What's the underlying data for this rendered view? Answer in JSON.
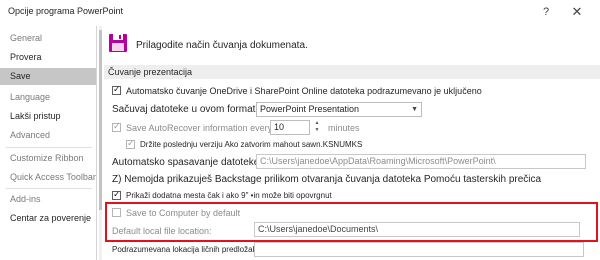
{
  "window": {
    "title": "Opcije programa PowerPoint",
    "help": "?",
    "close": "✕"
  },
  "sidebar": {
    "items": [
      {
        "label": "General",
        "muted": true
      },
      {
        "label": "Provera",
        "muted": false
      },
      {
        "label": "Save",
        "selected": true
      },
      {
        "label": "Language",
        "muted": true
      },
      {
        "label": "Lakši pristup",
        "muted": false
      },
      {
        "label": "Advanced",
        "muted": true
      },
      {
        "label": "Customize Ribbon",
        "muted": true
      },
      {
        "label": "Quick Access Toolbar",
        "muted": true
      },
      {
        "label": "Add-ins",
        "muted": true
      },
      {
        "label": "Centar za poverenje",
        "muted": false
      }
    ]
  },
  "main": {
    "header": "Prilagodite način čuvanja dokumenata.",
    "section_title": "Čuvanje prezentacija",
    "autosave_label": "Automatsko čuvanje OneDrive i SharePoint Online datoteka podrazumevano je uključeno",
    "format_label": "Sačuvaj datoteke u ovom formatu",
    "format_value": "PowerPoint Presentation",
    "autorecover_label": "Save AutoRecover information every",
    "autorecover_value": "10",
    "autorecover_unit": "minutes",
    "keep_last_label": "Držite poslednju verziju Ako zatvorim mahout sawn.KSNUMKS",
    "autorecover_location_label": "Automatsko spasavanje datoteke Lokacije:",
    "autorecover_location_value": "C:\\Users\\janedoe\\AppData\\Roaming\\Microsoft\\PowerPoint\\",
    "backstage_label": "Z) Nemojda prikazuješ Backstage prilikom otvaranja čuvanja datoteka Pomoću tasterskih prečica",
    "show_more_label": "Prikaži dodatna mesta čak i ako 9\" •in može biti opovrgnut",
    "save_to_computer_label": "Save to Computer by default",
    "default_local_label": "Default local file location:",
    "default_local_value": "C:\\Users\\janedoe\\Documents\\",
    "personal_templates_label": "Podrazumevana lokacija ličnih predložaka:"
  }
}
